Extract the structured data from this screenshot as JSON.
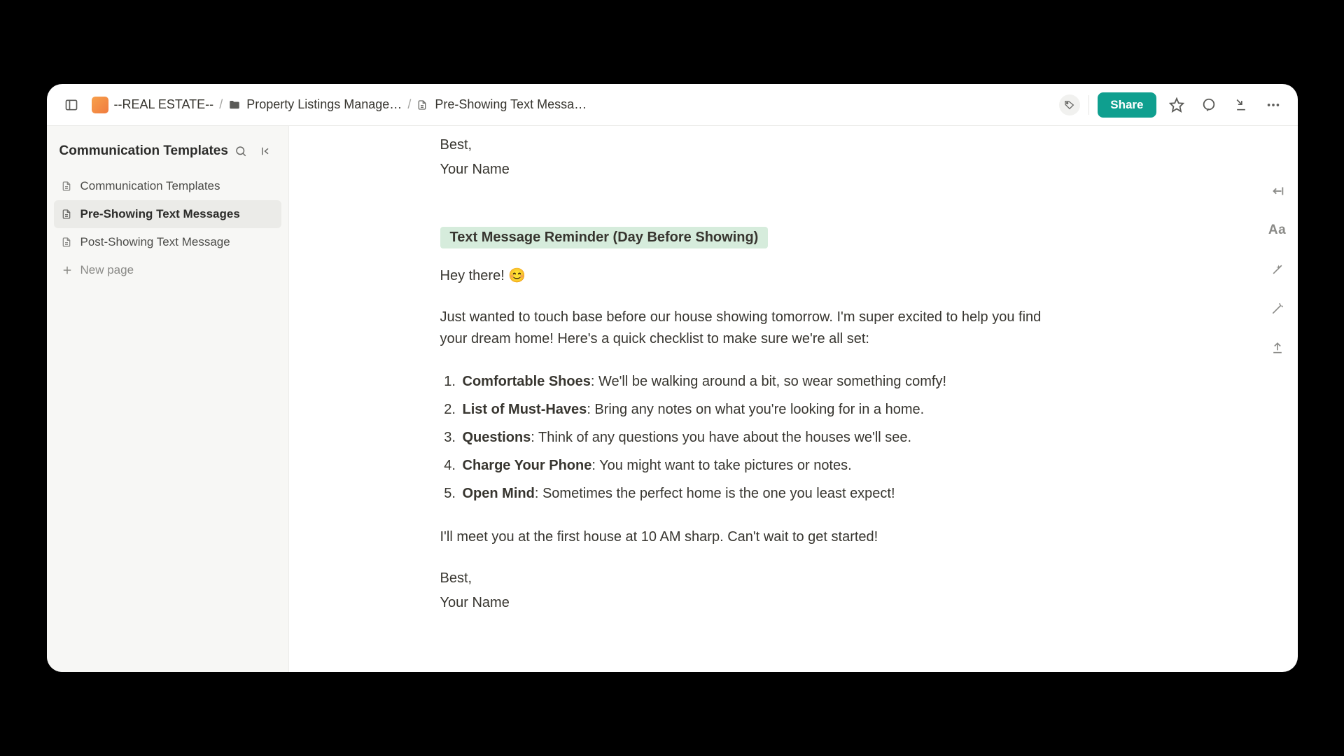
{
  "topbar": {
    "workspace": "--REAL ESTATE--",
    "folder": "Property Listings Manage…",
    "page": "Pre-Showing Text Messa…",
    "share": "Share"
  },
  "sidebar": {
    "title": "Communication Templates",
    "items": [
      {
        "label": "Communication Templates",
        "active": false
      },
      {
        "label": "Pre-Showing Text Messages",
        "active": true
      },
      {
        "label": "Post-Showing Text Message",
        "active": false
      }
    ],
    "new_page": "New page"
  },
  "doc": {
    "prev_signoff1": "Best,",
    "prev_signoff2": "Your Name",
    "section_title": "Text Message Reminder (Day Before Showing)",
    "greeting": "Hey there! 😊",
    "intro": "Just wanted to touch base before our house showing tomorrow. I'm super excited to help you find your dream home! Here's a quick checklist to make sure we're all set:",
    "checklist": [
      {
        "b": "Comfortable Shoes",
        "t": ": We'll be walking around a bit, so wear something comfy!"
      },
      {
        "b": "List of Must-Haves",
        "t": ": Bring any notes on what you're looking for in a home."
      },
      {
        "b": "Questions",
        "t": ": Think of any questions you have about the houses we'll see."
      },
      {
        "b": "Charge Your Phone",
        "t": ": You might want to take pictures or notes."
      },
      {
        "b": "Open Mind",
        "t": ": Sometimes the perfect home is the one you least expect!"
      }
    ],
    "meet": "I'll meet you at the first house at 10 AM sharp. Can't wait to get started!",
    "signoff1": "Best,",
    "signoff2": "Your Name"
  },
  "rail": {
    "aa": "Aa"
  }
}
